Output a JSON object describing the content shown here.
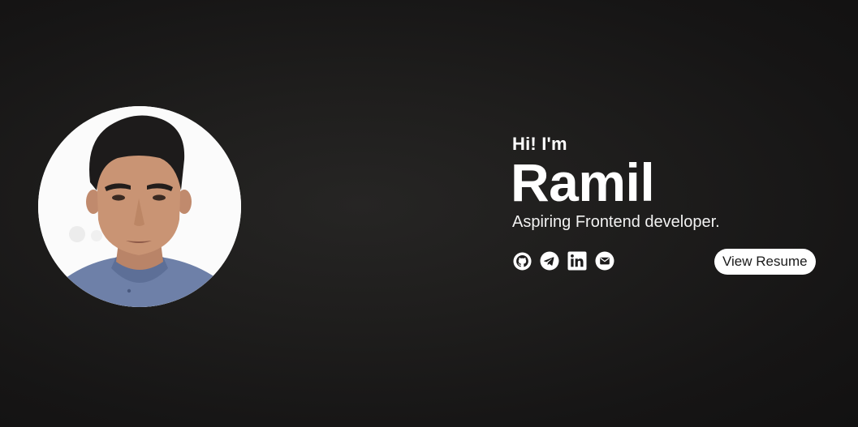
{
  "profile": {
    "greeting": "Hi! I'm",
    "name": "Ramil",
    "tagline": "Aspiring Frontend developer."
  },
  "socials": [
    {
      "icon": "github-icon"
    },
    {
      "icon": "telegram-icon"
    },
    {
      "icon": "linkedin-icon"
    },
    {
      "icon": "email-icon"
    }
  ],
  "actions": {
    "resume_label": "View Resume"
  },
  "colors": {
    "background": "#1f1e1d",
    "text": "#ffffff",
    "button_bg": "#ffffff",
    "button_text": "#1a1a1a"
  }
}
